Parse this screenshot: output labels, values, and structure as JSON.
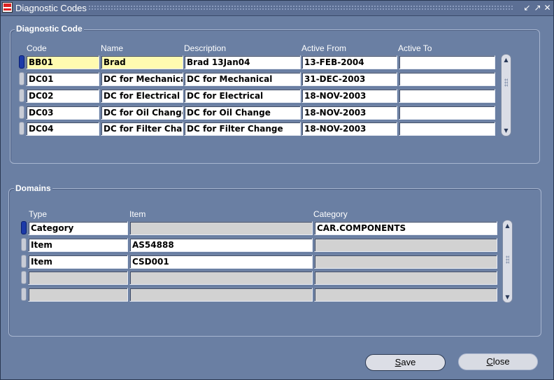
{
  "window": {
    "title": "Diagnostic Codes"
  },
  "diagnostic_code": {
    "title": "Diagnostic Code",
    "columns": [
      "Code",
      "Name",
      "Description",
      "Active From",
      "Active To"
    ],
    "rows": [
      {
        "code": "BB01",
        "name": "Brad",
        "description": "Brad 13Jan04",
        "active_from": "13-FEB-2004",
        "active_to": ""
      },
      {
        "code": "DC01",
        "name": "DC for Mechanical",
        "description": "DC for Mechanical",
        "active_from": "31-DEC-2003",
        "active_to": ""
      },
      {
        "code": "DC02",
        "name": "DC for Electrical",
        "description": "DC for Electrical",
        "active_from": "18-NOV-2003",
        "active_to": ""
      },
      {
        "code": "DC03",
        "name": "DC for Oil Change",
        "description": "DC for Oil Change",
        "active_from": "18-NOV-2003",
        "active_to": ""
      },
      {
        "code": "DC04",
        "name": "DC for Filter Change",
        "description": "DC for Filter Change",
        "active_from": "18-NOV-2003",
        "active_to": ""
      }
    ]
  },
  "domains": {
    "title": "Domains",
    "columns": [
      "Type",
      "Item",
      "Category"
    ],
    "rows": [
      {
        "type": "Category",
        "item": "",
        "category": "CAR.COMPONENTS"
      },
      {
        "type": "Item",
        "item": "AS54888",
        "category": ""
      },
      {
        "type": "Item",
        "item": "CSD001",
        "category": ""
      },
      {
        "type": "",
        "item": "",
        "category": ""
      },
      {
        "type": "",
        "item": "",
        "category": ""
      }
    ]
  },
  "buttons": {
    "save_first": "S",
    "save_rest": "ave",
    "close_first": "C",
    "close_rest": "lose"
  }
}
